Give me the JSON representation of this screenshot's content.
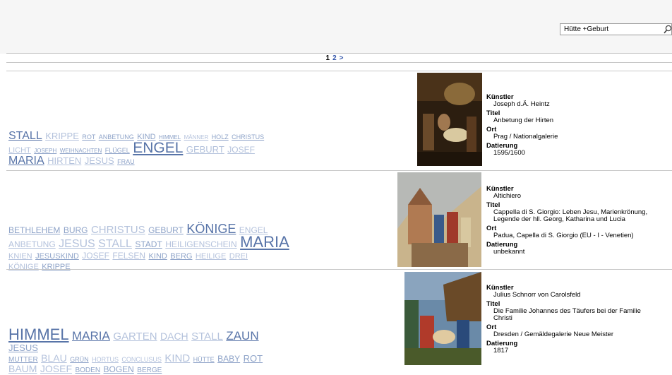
{
  "search": {
    "value": "Hütte +Geburt"
  },
  "pagination": {
    "current": "1",
    "page2": "2",
    "next": ">"
  },
  "labels": {
    "artist": "Künstler",
    "title": "Titel",
    "place": "Ort",
    "date": "Datierung"
  },
  "colors": {
    "tag_dark": "#5874a8",
    "tag_mid": "#8ea3c8",
    "tag_light": "#b4c2dc",
    "link": "#3355aa"
  },
  "results": [
    {
      "artist": "Joseph d.Ä. Heintz",
      "title_lines": [
        "Anbetung der Hirten"
      ],
      "place": "Prag / Nationalgalerie",
      "date": "1595/1600",
      "tag_lines": [
        [
          [
            "STALL",
            16,
            "d"
          ],
          [
            "KRIPPE",
            13,
            "l"
          ],
          [
            "ROT",
            9,
            "m"
          ],
          [
            "ANBETUNG",
            9,
            "m"
          ],
          [
            "KIND",
            11,
            "m"
          ],
          [
            "HIMMEL",
            8,
            "m"
          ],
          [
            "MÄNNER",
            8,
            "l"
          ],
          [
            "HOLZ",
            9,
            "m"
          ],
          [
            "CHRISTUS",
            9,
            "m"
          ]
        ],
        [
          [
            "LICHT",
            11,
            "l"
          ],
          [
            "JOSEPH",
            8,
            "m"
          ],
          [
            "WEIHNACHTEN",
            8,
            "m"
          ],
          [
            "FLÜGEL",
            9,
            "m"
          ],
          [
            "ENGEL",
            21,
            "d"
          ],
          [
            "GEBURT",
            13,
            "l"
          ],
          [
            "JOSEF",
            12,
            "l"
          ]
        ],
        [
          [
            "MARIA",
            16,
            "d"
          ],
          [
            "HIRTEN",
            13,
            "l"
          ],
          [
            "JESUS",
            13,
            "l"
          ],
          [
            "FRAU",
            9,
            "m"
          ]
        ]
      ]
    },
    {
      "artist": "Altichiero",
      "title_lines": [
        "Cappella di S. Giorgio: Leben Jesu, Marienkrönung,",
        "Legende der hll. Georg, Katharina und Lucia"
      ],
      "place": "Padua, Capella di S. Giorgio (EU - I - Venetien)",
      "date": "unbekannt",
      "tag_lines": [
        [
          [
            "BETHLEHEM",
            12,
            "m"
          ],
          [
            "BURG",
            12,
            "m"
          ],
          [
            "CHRISTUS",
            15,
            "l"
          ],
          [
            "GEBURT",
            12,
            "m"
          ],
          [
            "KÖNIGE",
            18,
            "d"
          ],
          [
            "ENGEL",
            12,
            "l"
          ]
        ],
        [
          [
            "ANBETUNG",
            12,
            "l"
          ],
          [
            "JESUS",
            16,
            "l"
          ],
          [
            "STALL",
            16,
            "l"
          ],
          [
            "STADT",
            12,
            "m"
          ],
          [
            "HEILIGENSCHEIN",
            12,
            "l"
          ],
          [
            "MARIA",
            22,
            "d"
          ]
        ],
        [
          [
            "KNIEN",
            11,
            "l"
          ],
          [
            "JESUSKIND",
            11,
            "m"
          ],
          [
            "JOSEF",
            12,
            "l"
          ],
          [
            "FELSEN",
            12,
            "l"
          ],
          [
            "KIND",
            11,
            "m"
          ],
          [
            "BERG",
            11,
            "m"
          ],
          [
            "HEILIGE",
            11,
            "l"
          ],
          [
            "DREI",
            11,
            "l"
          ]
        ],
        [
          [
            "KÖNIGE",
            11,
            "l"
          ],
          [
            "KRIPPE",
            11,
            "m"
          ]
        ]
      ]
    },
    {
      "artist": "Julius Schnorr von Carolsfeld",
      "title_lines": [
        "Die Familie Johannes des Täufers bei der Familie",
        "Christi"
      ],
      "place": "Dresden / Gemäldegalerie Neue Meister",
      "date": "1817",
      "tag_lines": [
        [
          [
            "HIMMEL",
            22,
            "d"
          ],
          [
            "MARIA",
            17,
            "d"
          ],
          [
            "GARTEN",
            15,
            "l"
          ],
          [
            "DACH",
            14,
            "l"
          ],
          [
            "STALL",
            15,
            "l"
          ],
          [
            "ZAUN",
            17,
            "d"
          ],
          [
            "JESUS",
            13,
            "m"
          ]
        ],
        [
          [
            "MUTTER",
            10,
            "m"
          ],
          [
            "BLAU",
            14,
            "l"
          ],
          [
            "GRÜN",
            9,
            "m"
          ],
          [
            "HORTUS",
            9,
            "l"
          ],
          [
            "CONCLUSUS",
            9,
            "l"
          ],
          [
            "KIND",
            15,
            "l"
          ],
          [
            "HÜTTE",
            9,
            "m"
          ],
          [
            "BABY",
            12,
            "m"
          ],
          [
            "ROT",
            13,
            "m"
          ]
        ],
        [
          [
            "BAUM",
            14,
            "l"
          ],
          [
            "JOSEF",
            14,
            "l"
          ],
          [
            "BODEN",
            10,
            "m"
          ],
          [
            "BOGEN",
            12,
            "m"
          ],
          [
            "BERGE",
            10,
            "m"
          ]
        ]
      ]
    }
  ]
}
